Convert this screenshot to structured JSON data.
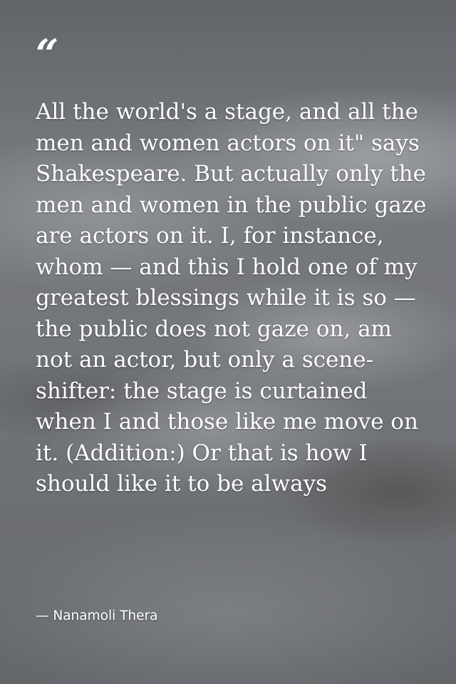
{
  "quote": {
    "mark": "“",
    "text": "All the world's a stage, and all the men and women actors on it\" says Shakespeare. But actually only the men and women in the public gaze are actors on it. I, for instance, whom — and this I hold one of my greatest blessings while it is so — the public does not gaze on, am not an actor, but only a scene-shifter: the stage is curtained when I and those like me move on it. (Addition:) Or that is how I should like it to be always",
    "author": "— Nanamoli Thera"
  }
}
